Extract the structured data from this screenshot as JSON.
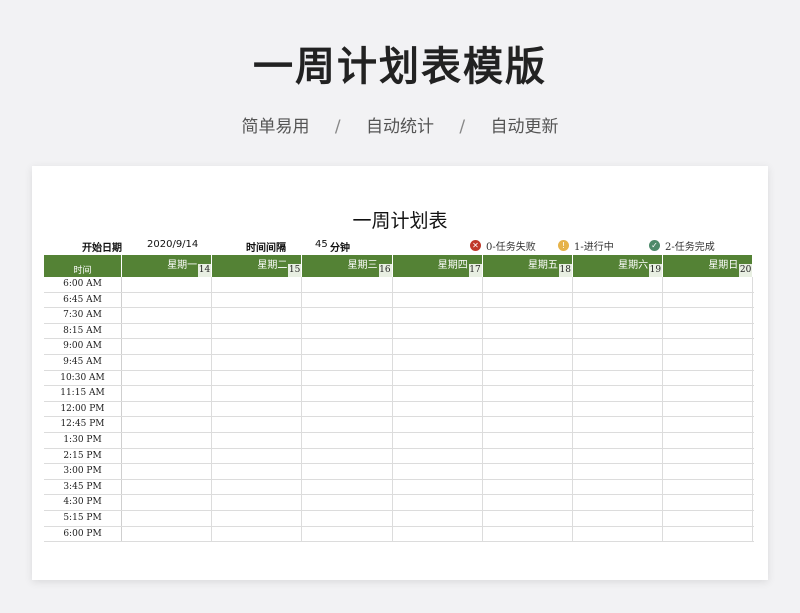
{
  "page": {
    "title": "一周计划表模版",
    "subtitle": [
      "简单易用",
      "自动统计",
      "自动更新"
    ],
    "separator": "/"
  },
  "sheet": {
    "title": "一周计划表",
    "start_date_label": "开始日期",
    "start_date_value": "2020/9/14",
    "interval_label": "时间间隔",
    "interval_value": "45",
    "interval_unit": "分钟",
    "legend": [
      {
        "icon": "x-circle-icon",
        "symbol": "✕",
        "label": "0-任务失败",
        "color": "#c0392b"
      },
      {
        "icon": "exclamation-circle-icon",
        "symbol": "!",
        "label": "1-进行中",
        "color": "#e6b34a"
      },
      {
        "icon": "check-circle-icon",
        "symbol": "✓",
        "label": "2-任务完成",
        "color": "#4e8a6a"
      }
    ],
    "time_header": "时间",
    "days": [
      {
        "name": "星期一",
        "date": "14"
      },
      {
        "name": "星期二",
        "date": "15"
      },
      {
        "name": "星期三",
        "date": "16"
      },
      {
        "name": "星期四",
        "date": "17"
      },
      {
        "name": "星期五",
        "date": "18"
      },
      {
        "name": "星期六",
        "date": "19"
      },
      {
        "name": "星期日",
        "date": "20"
      }
    ],
    "times": [
      "6:00 AM",
      "6:45 AM",
      "7:30 AM",
      "8:15 AM",
      "9:00 AM",
      "9:45 AM",
      "10:30 AM",
      "11:15 AM",
      "12:00 PM",
      "12:45 PM",
      "1:30 PM",
      "2:15 PM",
      "3:00 PM",
      "3:45 PM",
      "4:30 PM",
      "5:15 PM",
      "6:00 PM"
    ],
    "header_color": "#548235"
  }
}
